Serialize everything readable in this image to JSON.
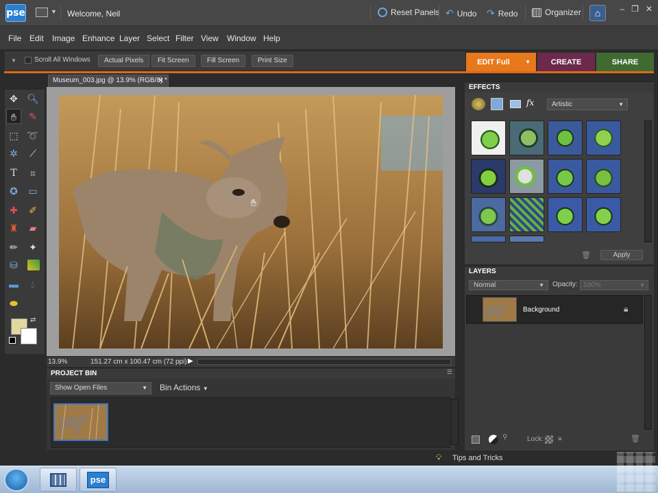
{
  "app": {
    "logo": "pse",
    "welcome": "Welcome, Neil"
  },
  "top_actions": {
    "reset_panels": "Reset Panels",
    "undo": "Undo",
    "redo": "Redo",
    "organizer": "Organizer"
  },
  "menu": [
    "File",
    "Edit",
    "Image",
    "Enhance",
    "Layer",
    "Select",
    "Filter",
    "View",
    "Window",
    "Help"
  ],
  "options": {
    "scroll_all": "Scroll All Windows",
    "actual_pixels": "Actual Pixels",
    "fit_screen": "Fit Screen",
    "fill_screen": "Fill Screen",
    "print_size": "Print Size"
  },
  "modes": {
    "edit": "EDIT Full",
    "create": "CREATE",
    "share": "SHARE",
    "colors": {
      "edit": "#e8781c",
      "create": "#6b2a4c",
      "share": "#3f6b32"
    }
  },
  "document": {
    "tab_title": "Museum_003.jpg @ 13.9% (RGB/8) *",
    "zoom": "13.9%",
    "dimensions": "151.27 cm x 100.47 cm (72 ppi)"
  },
  "project_bin": {
    "title": "PROJECT BIN",
    "show": "Show Open Files",
    "bin_actions": "Bin Actions"
  },
  "effects": {
    "title": "EFFECTS",
    "category": "Artistic",
    "apply": "Apply"
  },
  "layers": {
    "title": "LAYERS",
    "blend_mode": "Normal",
    "opacity_label": "Opacity:",
    "opacity_value": "100%",
    "layer_name": "Background",
    "lock_label": "Lock:"
  },
  "tips": {
    "label": "Tips and Tricks"
  },
  "taskbar": {
    "pse_label": "pse"
  }
}
